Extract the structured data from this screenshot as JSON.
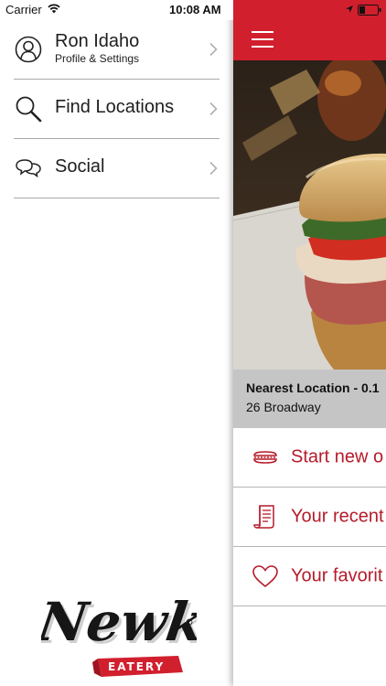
{
  "status_bar": {
    "carrier": "Carrier",
    "time": "10:08 AM"
  },
  "drawer": {
    "items": [
      {
        "title": "Ron Idaho",
        "subtitle": "Profile & Settings",
        "icon": "user-icon"
      },
      {
        "title": "Find Locations",
        "icon": "search-icon"
      },
      {
        "title": "Social",
        "icon": "chat-bubbles-icon"
      }
    ],
    "logo": {
      "brand": "Newk's",
      "tagline": "EATERY"
    }
  },
  "main": {
    "nearest_location": {
      "title": "Nearest Location - 0.1",
      "address": "26 Broadway"
    },
    "actions": [
      {
        "label": "Start new o",
        "icon": "sandwich-icon"
      },
      {
        "label": "Your recent",
        "icon": "receipt-icon"
      },
      {
        "label": "Your favorit",
        "icon": "heart-icon"
      }
    ]
  },
  "colors": {
    "brand_red": "#d11f2e",
    "action_text": "#b51b2a",
    "nearest_bar": "#c5c5c5"
  }
}
